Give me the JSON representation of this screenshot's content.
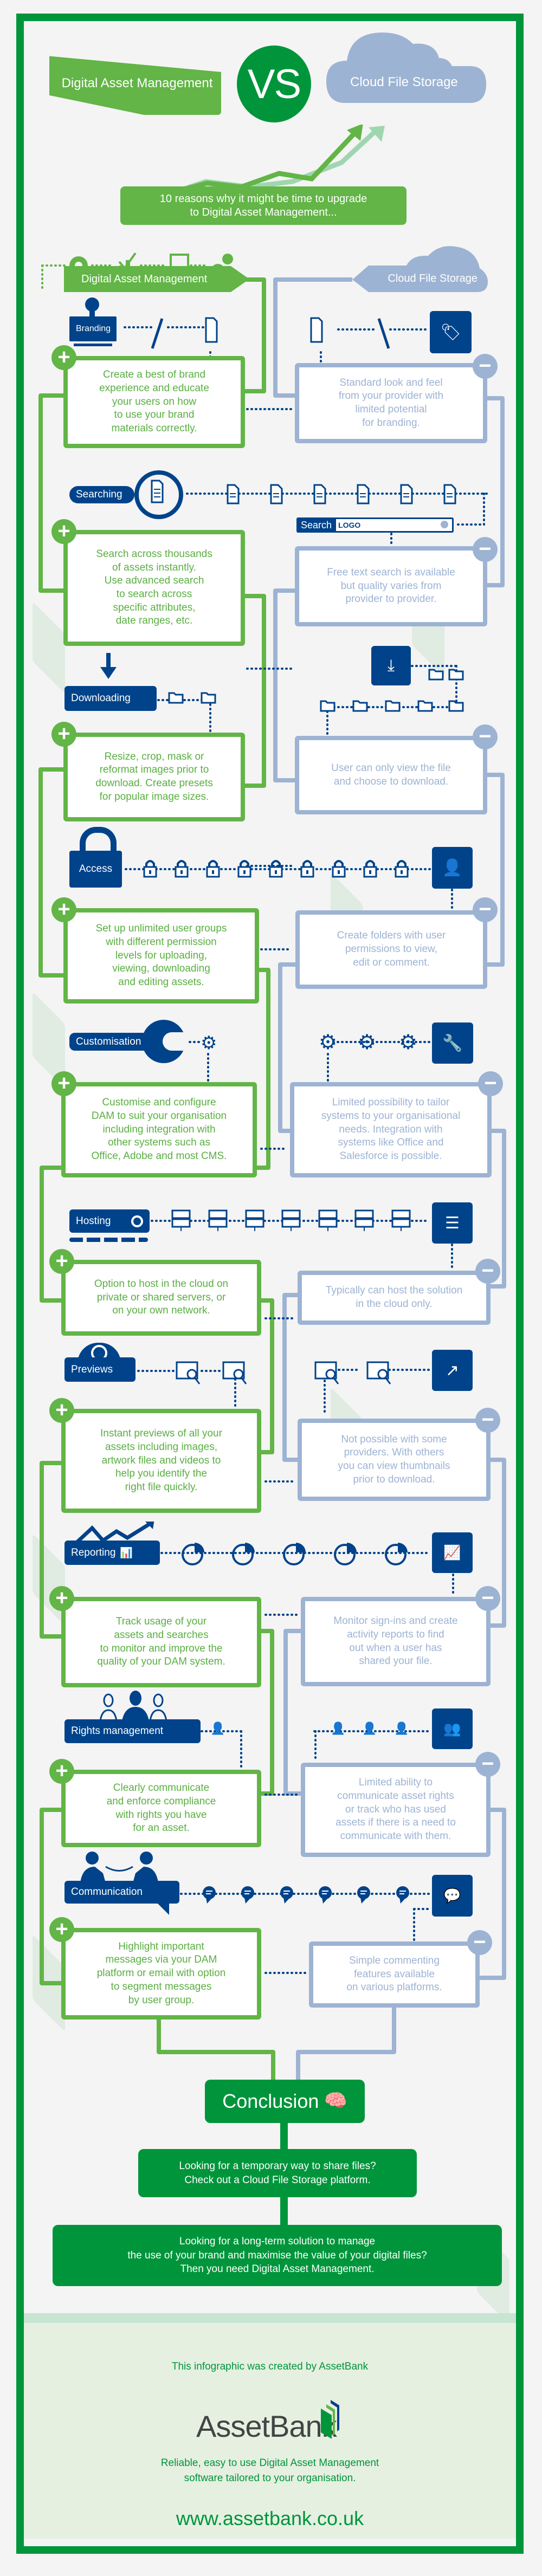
{
  "header": {
    "dam_title": "Digital Asset Management",
    "vs_label": "VS",
    "cloud_title": "Cloud File Storage",
    "subtitle": "10 reasons why it might be time to upgrade\nto Digital Asset Management..."
  },
  "columns": {
    "left_label": "Digital Asset Management",
    "right_label": "Cloud File Storage"
  },
  "colors": {
    "brand_green": "#00953b",
    "dam_green": "#62b546",
    "cloud_blue": "#9db3d3",
    "icon_navy": "#00438a"
  },
  "sections": [
    {
      "name": "Branding",
      "dam_icon": "stamp-icon",
      "cfs_icon": "tag-icon",
      "dam_text": "Create a best of brand\nexperience and educate\nyour users on how\nto use your brand\nmaterials correctly.",
      "cfs_text": "Standard look and feel\nfrom your provider with\nlimited potential\nfor branding."
    },
    {
      "name": "Searching",
      "dam_icon": "magnifier-document-icon",
      "cfs_icon": "search-bar",
      "search_label": "Search",
      "search_value": "LOGO",
      "dam_text": "Search across thousands\nof assets instantly.\nUse advanced search\nto search across\nspecific attributes,\ndate ranges, etc.",
      "cfs_text": "Free text search is available\nbut quality varies from\nprovider to provider."
    },
    {
      "name": "Downloading",
      "dam_icon": "down-arrow-icon",
      "cfs_icon": "download-icon",
      "dam_text": "Resize, crop, mask or\nreformat images prior to\ndownload. Create presets\nfor popular image sizes.",
      "cfs_text": "User can only view the file\nand choose to download."
    },
    {
      "name": "Access",
      "dam_icon": "padlock-icon",
      "cfs_icon": "user-lock-icon",
      "dam_text": "Set up unlimited user groups\nwith different permission\nlevels for uploading,\nviewing, downloading\nand editing assets.",
      "cfs_text": "Create folders with user\npermissions to view,\nedit or comment."
    },
    {
      "name": "Customisation",
      "dam_icon": "wrench-icon",
      "cfs_icon": "wrench-icon",
      "dam_text": "Customise and configure\nDAM to suit your organisation\nincluding integration with\nother systems such as\nOffice, Adobe and most CMS.",
      "cfs_text": "Limited possibility to tailor\nsystems to your organisational\nneeds. Integration with\nsystems like Office and\nSalesforce is possible."
    },
    {
      "name": "Hosting",
      "dam_icon": "server-icon",
      "cfs_icon": "server-icon",
      "dam_text": "Option to host in the cloud on\nprivate or shared servers, or\non your own network.",
      "cfs_text": "Typically can host the solution\nin the cloud only."
    },
    {
      "name": "Previews",
      "dam_icon": "eye-icon",
      "cfs_icon": "expand-image-icon",
      "dam_text": "Instant previews of all your\nassets including images,\nartwork files and videos to\nhelp you identify the\nright file quickly.",
      "cfs_text": "Not possible with some\nproviders. With others\nyou can view thumbnails\nprior to download."
    },
    {
      "name": "Reporting",
      "dam_icon": "chart-up-icon",
      "cfs_icon": "bar-chart-icon",
      "dam_text": "Track usage of your\nassets and searches\nto monitor and improve the\nquality of your DAM system.",
      "cfs_text": "Monitor sign-ins and create\nactivity reports to find\nout when a user has\nshared your file."
    },
    {
      "name": "Rights management",
      "dam_icon": "users-icon",
      "cfs_icon": "group-icon",
      "dam_text": "Clearly communicate\nand enforce compliance\nwith rights you have\nfor an asset.",
      "cfs_text": "Limited ability to\ncommunicate asset rights\nor track who has used\nassets if there is a need to\ncommunicate with them."
    },
    {
      "name": "Communication",
      "dam_icon": "people-talking-icon",
      "cfs_icon": "chat-bubble-icon",
      "dam_text": "Highlight important\nmessages via your DAM\nplatform or email with option\nto segment messages\nby user group.",
      "cfs_text": "Simple commenting\nfeatures available\non various platforms."
    }
  ],
  "conclusion": {
    "title": "Conclusion",
    "cfs_advice": "Looking for a temporary way to share files?\nCheck out a Cloud File Storage platform.",
    "dam_advice": "Looking for a long-term solution to manage\nthe use of your brand and maximise the value of your digital files?\nThen you need Digital Asset Management."
  },
  "footer": {
    "credit": "This infographic was created by AssetBank",
    "logo_text": "AssetBank",
    "tagline": "Reliable, easy to use Digital Asset Management\nsoftware tailored to your organisation.",
    "url": "www.assetbank.co.uk"
  }
}
